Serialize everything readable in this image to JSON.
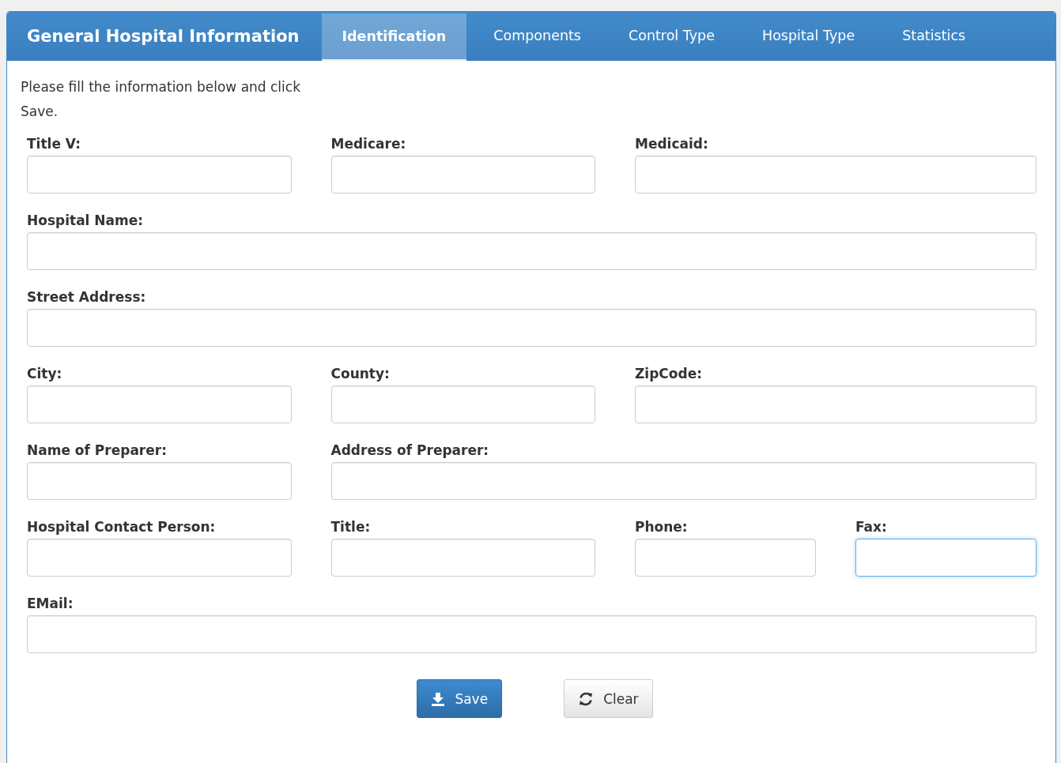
{
  "header": {
    "title": "General Hospital Information",
    "tabs": [
      {
        "label": "Identification",
        "selected": true
      },
      {
        "label": "Components",
        "selected": false
      },
      {
        "label": "Control Type",
        "selected": false
      },
      {
        "label": "Hospital Type",
        "selected": false
      },
      {
        "label": "Statistics",
        "selected": false
      }
    ]
  },
  "intro": "Please fill the information below and click Save.",
  "rows": [
    {
      "fields": [
        {
          "label": "Title V:",
          "focused": false
        },
        {
          "label": "Medicare:",
          "focused": false
        },
        {
          "label": "Medicaid:",
          "focused": false
        }
      ]
    },
    {
      "fields": [
        {
          "label": "Hospital Name:",
          "focused": false
        }
      ]
    },
    {
      "fields": [
        {
          "label": "Street Address:",
          "focused": false
        }
      ]
    },
    {
      "fields": [
        {
          "label": "City:",
          "focused": false
        },
        {
          "label": "County:",
          "focused": false
        },
        {
          "label": "ZipCode:",
          "focused": false
        }
      ]
    },
    {
      "fields": [
        {
          "label": "Name of Preparer:",
          "focused": false
        },
        {
          "label": "Address of Preparer:",
          "focused": false
        }
      ]
    },
    {
      "fields": [
        {
          "label": "Hospital Contact Person:",
          "focused": false
        },
        {
          "label": "Title:",
          "focused": false
        },
        {
          "label": "Phone:",
          "focused": false
        },
        {
          "label": "Fax:",
          "focused": true
        }
      ]
    },
    {
      "fields": [
        {
          "label": "EMail:",
          "focused": false
        }
      ]
    }
  ],
  "buttons": [
    {
      "kind": "save",
      "label": "Save"
    },
    {
      "kind": "clear",
      "label": "Clear"
    }
  ]
}
